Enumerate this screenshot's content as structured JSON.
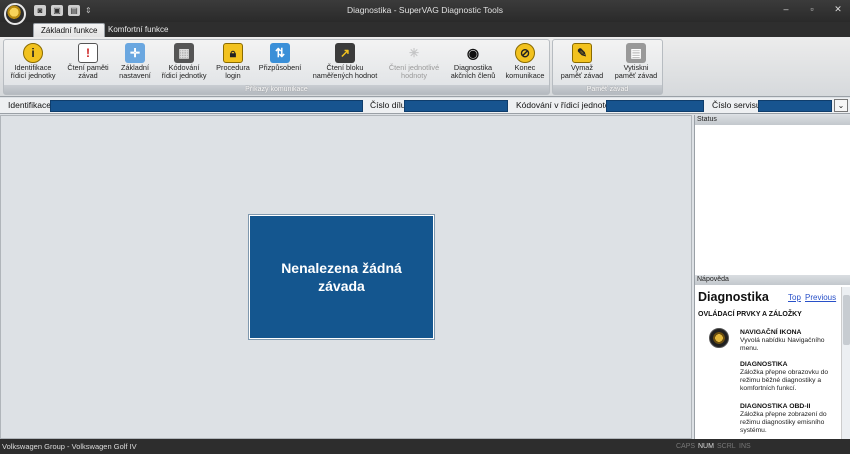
{
  "window": {
    "title": "Diagnostika - SuperVAG Diagnostic Tools",
    "controls": [
      "–",
      "▫",
      "✕"
    ]
  },
  "quick_access": {
    "icons": [
      "camera-icon",
      "disk-icon",
      "print-icon",
      "dropdown-icon"
    ]
  },
  "tabs": [
    {
      "label": "Základní funkce",
      "active": true
    },
    {
      "label": "Komfortní funkce",
      "active": false
    }
  ],
  "ribbon": {
    "groups": [
      {
        "label": "Příkazy komunikace",
        "buttons": [
          {
            "label1": "Identifikace",
            "label2": "řídicí jednotky",
            "icon": "info-icon",
            "disabled": false
          },
          {
            "label1": "Čtení paměti",
            "label2": "závad",
            "icon": "list-warning-icon",
            "disabled": false
          },
          {
            "label1": "Základní",
            "label2": "nastavení",
            "icon": "crosshair-icon",
            "disabled": false
          },
          {
            "label1": "Kódování",
            "label2": "řídicí jednotky",
            "icon": "ecu-icon",
            "disabled": false
          },
          {
            "label1": "Procedura",
            "label2": "login",
            "icon": "lock-icon",
            "disabled": false
          },
          {
            "label1": "Přizpůsobení",
            "label2": "",
            "icon": "adapt-icon",
            "disabled": false
          },
          {
            "label1": "Čtení bloku",
            "label2": "naměřených hodnot",
            "icon": "chart-icon",
            "disabled": false
          },
          {
            "label1": "Čtení jednotlivé",
            "label2": "hodnoty",
            "icon": "spinner-icon",
            "disabled": true
          },
          {
            "label1": "Diagnostika",
            "label2": "akčních členů",
            "icon": "eye-icon",
            "disabled": false
          },
          {
            "label1": "Konec",
            "label2": "komunikace",
            "icon": "disconnect-icon",
            "disabled": false
          }
        ]
      },
      {
        "label": "Paměť závad",
        "buttons": [
          {
            "label1": "Vymaž",
            "label2": "paměť závad",
            "icon": "eraser-icon",
            "disabled": false
          },
          {
            "label1": "Vytiskni",
            "label2": "paměť závad",
            "icon": "printer-icon",
            "disabled": false
          }
        ]
      }
    ]
  },
  "infobar": {
    "identification_label": "Identifikace",
    "part_number_label": "Číslo dílu",
    "coding_label": "Kódování v řídicí jednotce",
    "service_number_label": "Číslo servisu",
    "collapse_icon": "chevron-double-down-icon"
  },
  "main": {
    "status_card_text": "Nenalezena žádná závada"
  },
  "status_panel": {
    "title": "Status"
  },
  "help_panel": {
    "header": "Nápověda",
    "title": "Diagnostika",
    "link_top": "Top",
    "link_previous": "Previous",
    "subtitle": "OVLÁDACÍ PRVKY A ZÁLOŽKY",
    "items": [
      {
        "heading": "NAVIGAČNÍ IKONA",
        "text": "Vyvolá nabídku Navigačního menu."
      },
      {
        "heading": "DIAGNOSTIKA",
        "text": "Záložka přepne obrazovku do režimu běžné diagnostiky a komfortních funkcí."
      },
      {
        "heading": "DIAGNOSTIKA OBD-II",
        "text": "Záložka přepne zobrazení do režimu diagnostiky emisního systému."
      }
    ]
  },
  "statusbar": {
    "vehicle": "Volkswagen Group - Volkswagen Golf IV",
    "indicators": [
      {
        "label": "CAPS",
        "on": false
      },
      {
        "label": "NUM",
        "on": true
      },
      {
        "label": "SCRL",
        "on": false
      },
      {
        "label": "INS",
        "on": false
      }
    ]
  }
}
